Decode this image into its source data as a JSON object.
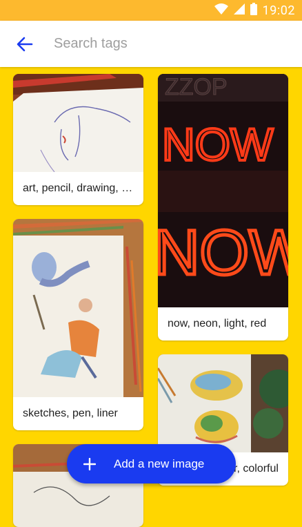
{
  "status": {
    "time": "19:02"
  },
  "search": {
    "placeholder": "Search tags"
  },
  "cards": [
    {
      "caption": "art, pencil, drawing, sketch"
    },
    {
      "caption": "now, neon, light, red"
    },
    {
      "caption": "sketches, pen, liner"
    },
    {
      "caption": "art, watercolor, colorful"
    },
    {
      "caption": ""
    }
  ],
  "fab": {
    "label": "Add a new image"
  },
  "colors": {
    "accent": "#1A3BF0",
    "background": "#FFD600",
    "status_bar": "#FDB92E"
  }
}
